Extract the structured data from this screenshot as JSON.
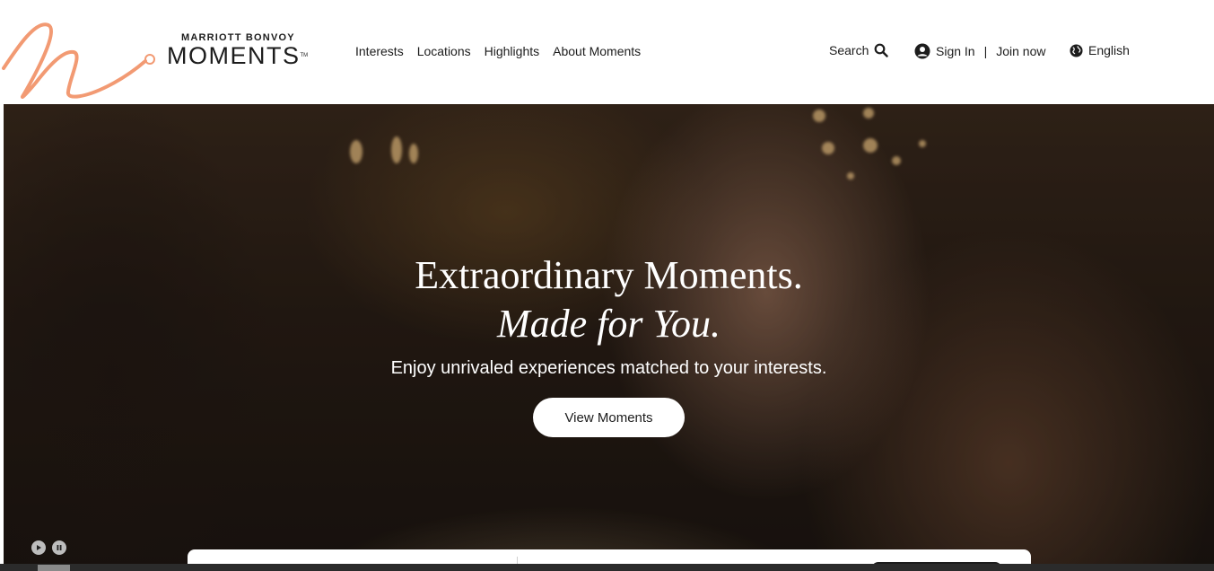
{
  "brand": {
    "top": "MARRIOTT BONVOY",
    "main": "MOMENTS",
    "tm": "TM",
    "accent_color": "#f29a73"
  },
  "nav": {
    "items": [
      {
        "label": "Interests"
      },
      {
        "label": "Locations"
      },
      {
        "label": "Highlights"
      },
      {
        "label": "About Moments"
      }
    ]
  },
  "utility": {
    "search_label": "Search",
    "search_icon": "search-icon",
    "sign_in_label": "Sign In",
    "separator": "|",
    "join_label": "Join now",
    "account_icon": "account-icon",
    "language_label": "English",
    "language_icon": "globe-icon"
  },
  "hero": {
    "title": "Extraordinary Moments.",
    "subtitle": "Made for You.",
    "description": "Enjoy unrivaled experiences matched to your interests.",
    "cta_label": "View Moments",
    "play_icon": "play-icon",
    "pause_icon": "pause-icon"
  }
}
